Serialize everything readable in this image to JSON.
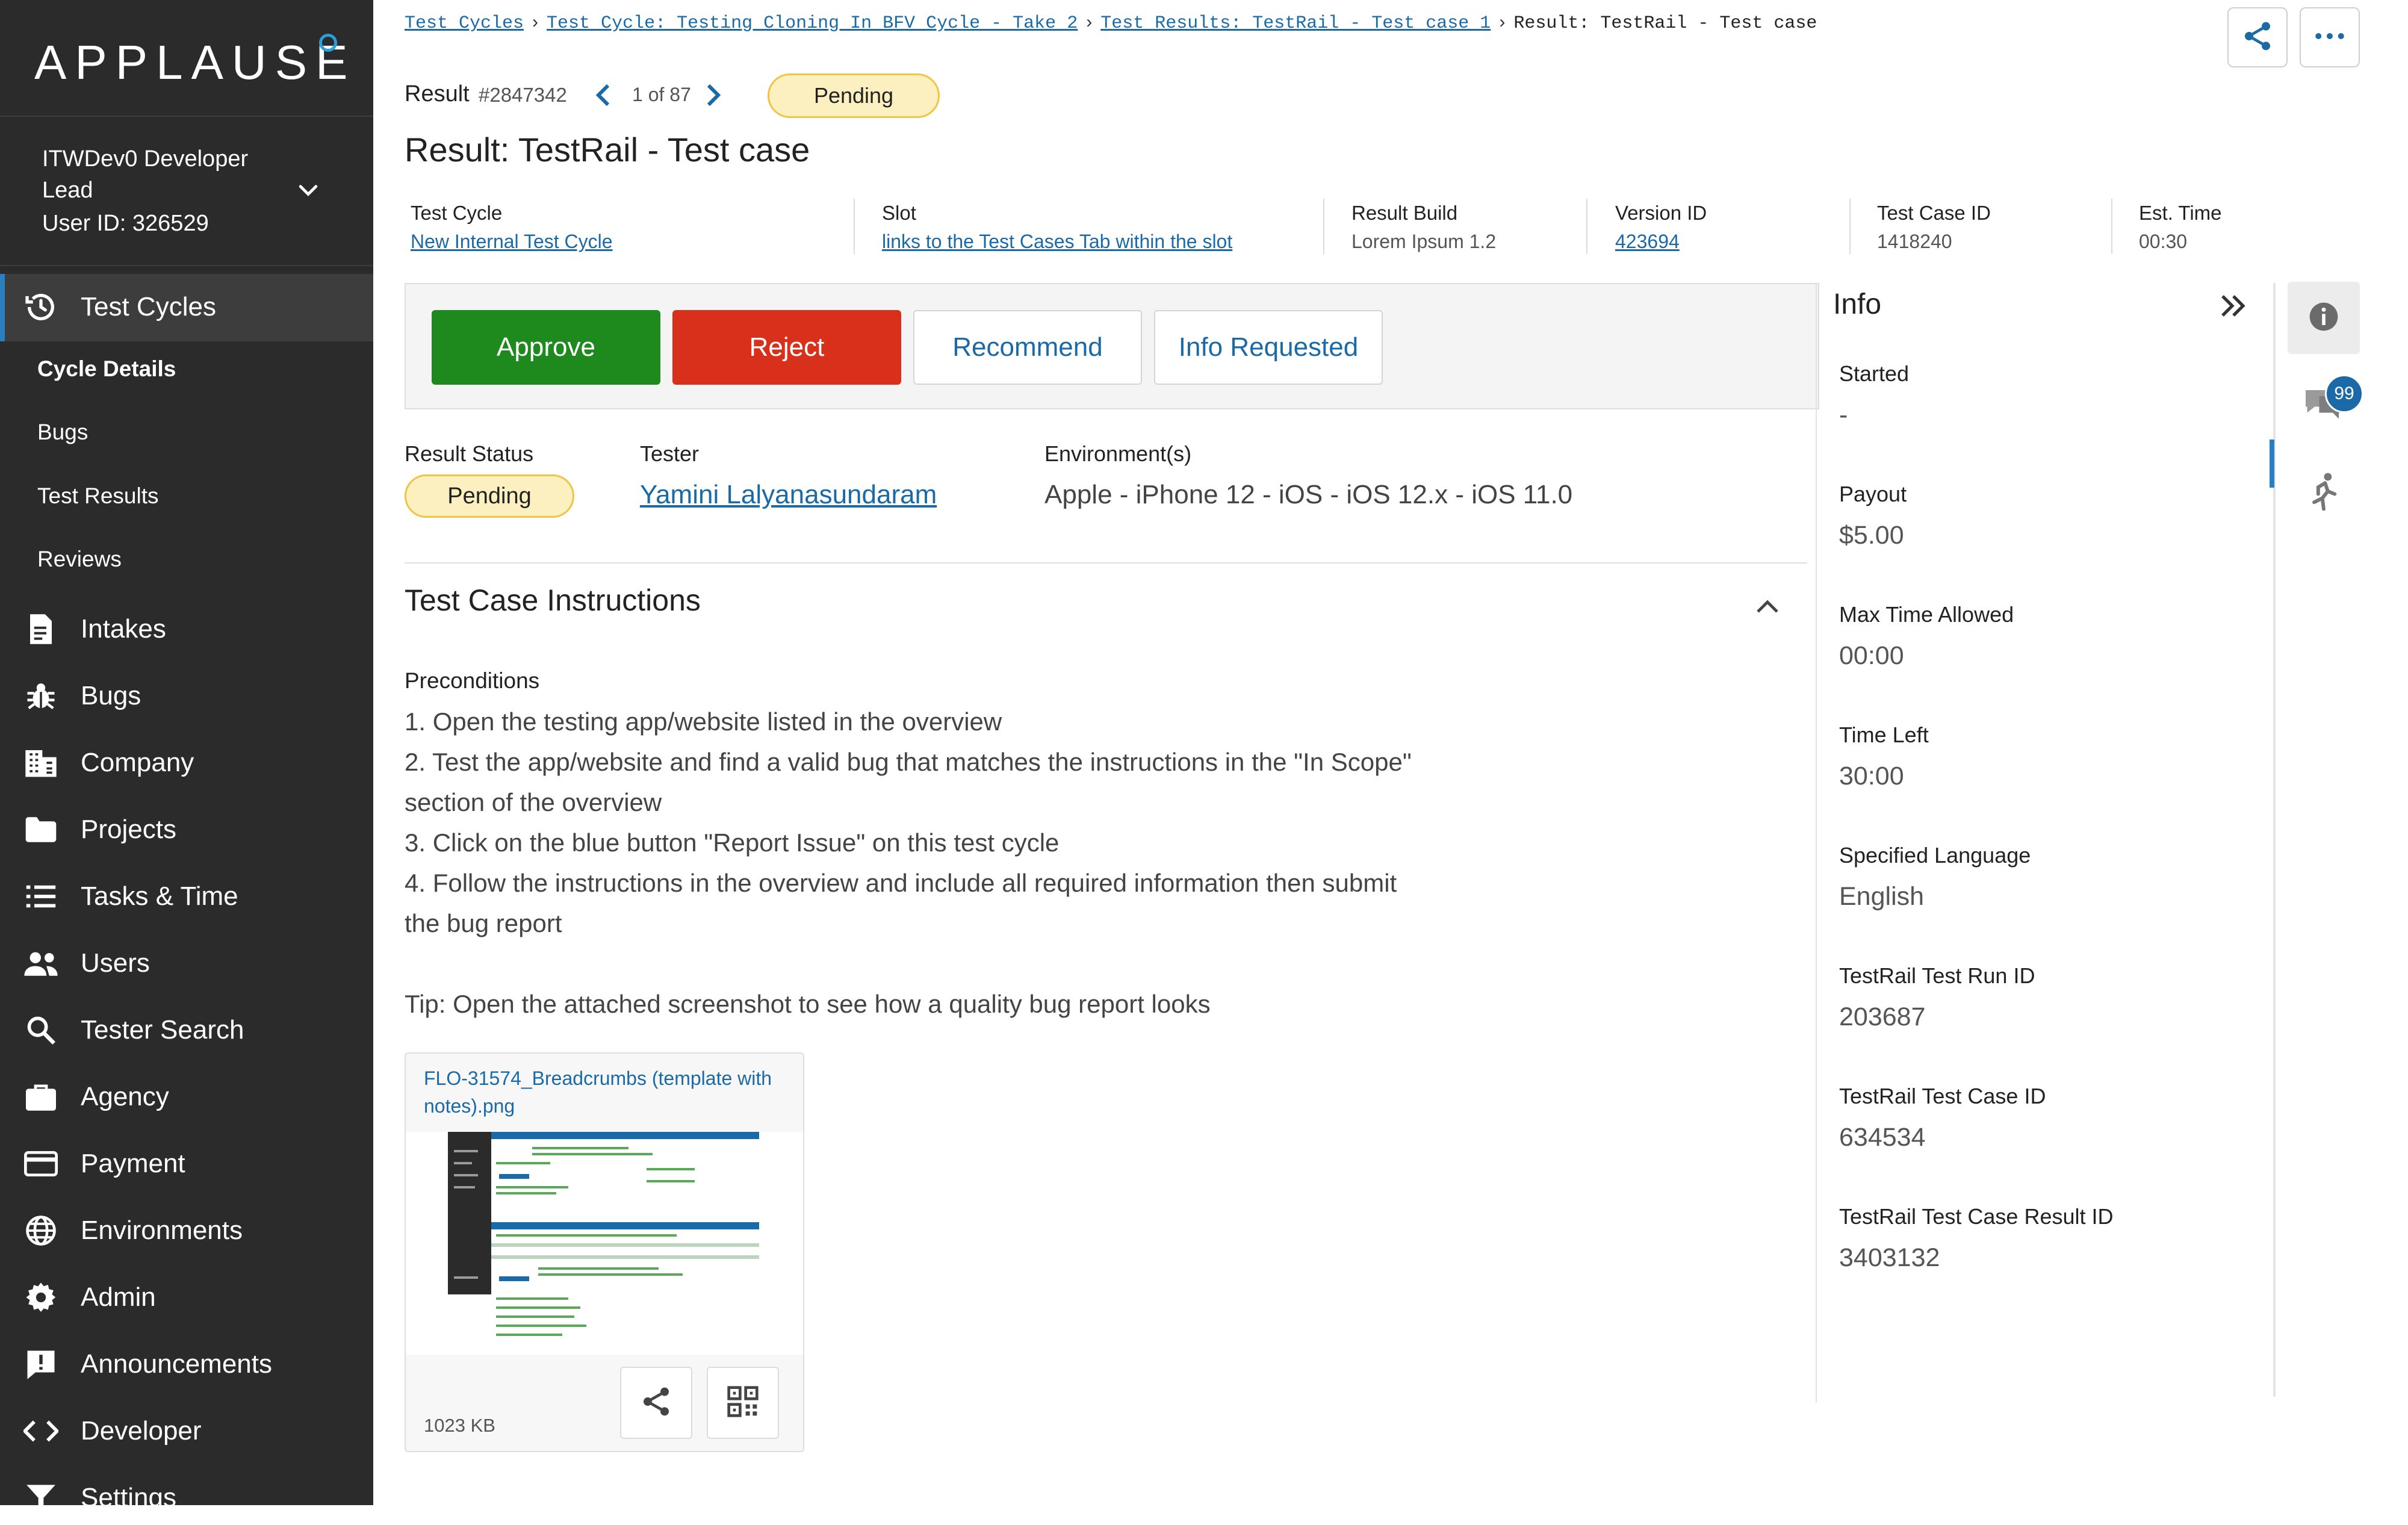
{
  "app": {
    "logo_text": "APPLAUSE"
  },
  "account": {
    "name": "ITWDev0 Developer Lead",
    "user_id": "User ID: 326529"
  },
  "sidebar": {
    "active_item": "Test Cycles",
    "sub_items": [
      "Cycle Details",
      "Bugs",
      "Test Results",
      "Reviews"
    ],
    "items": [
      {
        "label": "Intakes",
        "icon": "document-icon"
      },
      {
        "label": "Bugs",
        "icon": "bug-icon"
      },
      {
        "label": "Company",
        "icon": "building-icon"
      },
      {
        "label": "Projects",
        "icon": "folder-icon"
      },
      {
        "label": "Tasks & Time",
        "icon": "list-icon"
      },
      {
        "label": "Users",
        "icon": "users-icon"
      },
      {
        "label": "Tester Search",
        "icon": "search-icon"
      },
      {
        "label": "Agency",
        "icon": "briefcase-icon"
      },
      {
        "label": "Payment",
        "icon": "credit-card-icon"
      },
      {
        "label": "Environments",
        "icon": "globe-icon"
      },
      {
        "label": "Admin",
        "icon": "gear-icon"
      },
      {
        "label": "Announcements",
        "icon": "announcement-icon"
      },
      {
        "label": "Developer",
        "icon": "code-icon"
      },
      {
        "label": "Settings",
        "icon": "filter-icon"
      }
    ]
  },
  "breadcrumb": {
    "items": [
      "Test Cycles",
      "Test Cycle: Testing Cloning In BFV Cycle - Take 2",
      "Test Results: TestRail - Test case 1",
      "Result: TestRail - Test case"
    ]
  },
  "header": {
    "result_label": "Result",
    "result_id": "#2847342",
    "pager": "1 of 87",
    "status": "Pending",
    "title": "Result: TestRail - Test case"
  },
  "meta": [
    {
      "key": "Test Cycle",
      "value": "New Internal Test Cycle"
    },
    {
      "key": "Slot",
      "value": "links to the Test Cases Tab within the slot"
    },
    {
      "key": "Result Build",
      "value": "Lorem Ipsum 1.2"
    },
    {
      "key": "Version ID",
      "value": "423694"
    },
    {
      "key": "Test Case ID",
      "value": "1418240"
    },
    {
      "key": "Est. Time",
      "value": "00:30"
    }
  ],
  "actions": {
    "approve": "Approve",
    "reject": "Reject",
    "recommend": "Recommend",
    "info_requested": "Info Requested"
  },
  "status_row": {
    "result_status_label": "Result Status",
    "result_status": "Pending",
    "tester_label": "Tester",
    "tester": "Yamini Lalyanasundaram",
    "env_label": "Environment(s)",
    "env": "Apple - iPhone 12 - iOS - iOS 12.x - iOS 11.0"
  },
  "instructions": {
    "title": "Test Case Instructions",
    "preconditions_label": "Preconditions",
    "lines": [
      "1. Open the testing app/website listed in the overview",
      "2. Test the app/website and find a valid bug that matches the instructions in the \"In Scope\" section of the overview",
      "3. Click on the blue button \"Report Issue\" on this test cycle",
      "4. Follow the instructions in the overview and include all required information then submit the bug report",
      "",
      "Tip: Open the attached screenshot to see how a quality bug report looks"
    ]
  },
  "attachment": {
    "filename": "FLO-31574_Breadcrumbs (template with notes).png",
    "size": "1023 KB"
  },
  "info": {
    "title": "Info",
    "fields": [
      {
        "key": "Started",
        "value": "-"
      },
      {
        "key": "Payout",
        "value": "$5.00"
      },
      {
        "key": "Max Time Allowed",
        "value": "00:00"
      },
      {
        "key": "Time Left",
        "value": "30:00"
      },
      {
        "key": "Specified Language",
        "value": "English"
      },
      {
        "key": "TestRail Test Run ID",
        "value": "203687"
      },
      {
        "key": "TestRail Test Case ID",
        "value": "634534"
      },
      {
        "key": "TestRail Test Case Result ID",
        "value": "3403132"
      }
    ]
  },
  "right_tabs": {
    "comments_count": "99"
  },
  "colors": {
    "sidebar_bg": "#2b2b2b",
    "accent": "#1a6aa8",
    "approve": "#1e8a1e",
    "reject": "#d8301a",
    "pending_bg": "#fdf0c0",
    "pending_border": "#f0c544"
  }
}
